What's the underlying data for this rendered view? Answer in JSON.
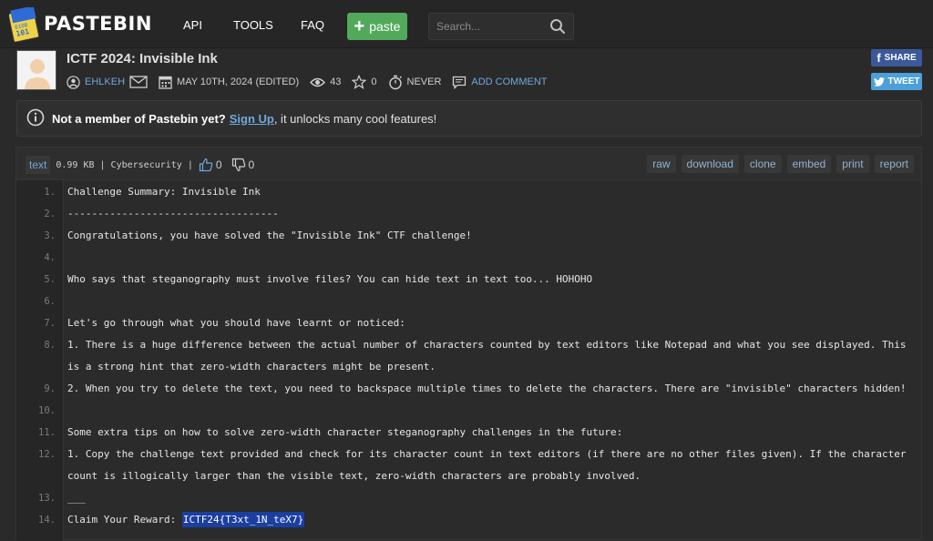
{
  "header": {
    "brand": "PASTEBIN",
    "logo_text": "1010 0100 101",
    "nav": [
      "API",
      "TOOLS",
      "FAQ"
    ],
    "paste_button": "paste",
    "search_placeholder": "Search..."
  },
  "post": {
    "title": "ICTF 2024: Invisible Ink",
    "author": "EHLKEH",
    "date": "MAY 10TH, 2024 (EDITED)",
    "views": "43",
    "stars": "0",
    "expires": "NEVER",
    "add_comment": "ADD COMMENT"
  },
  "share": {
    "facebook": "SHARE",
    "twitter": "TWEET"
  },
  "notice": {
    "bold": "Not a member of Pastebin yet?",
    "signup": "Sign Up",
    "rest": ", it unlocks many cool features!"
  },
  "toolbar": {
    "syntax": "text",
    "size_info": "0.99 KB | Cybersecurity |",
    "likes": "0",
    "dislikes": "0",
    "actions": [
      "raw",
      "download",
      "clone",
      "embed",
      "print",
      "report"
    ]
  },
  "code": {
    "lines": [
      {
        "n": "1.",
        "t": "Challenge Summary: Invisible Ink"
      },
      {
        "n": "2.",
        "t": "-----------------------------------"
      },
      {
        "n": "3.",
        "t": "Congratulations, you have solved the \"Invisible Ink\" CTF challenge!"
      },
      {
        "n": "4.",
        "t": ""
      },
      {
        "n": "5.",
        "t": "Who says that steganography must involve files? You can hide text in text too... HOHOHO"
      },
      {
        "n": "6.",
        "t": ""
      },
      {
        "n": "7.",
        "t": "Let's go through what you should have learnt or noticed:"
      },
      {
        "n": "8.",
        "t": "1. There is a huge difference between the actual number of characters counted by text editors like Notepad and what you see displayed. This"
      },
      {
        "n": "",
        "t": "is a strong hint that zero-width characters might be present."
      },
      {
        "n": "9.",
        "t": "2. When you try to delete the text, you need to backspace multiple times to delete the characters. There are \"invisible\" characters hidden!"
      },
      {
        "n": "10.",
        "t": ""
      },
      {
        "n": "11.",
        "t": "Some extra tips on how to solve zero-width character steganography challenges in the future:"
      },
      {
        "n": "12.",
        "t": "1. Copy the challenge text provided and check for its character count in text editors (if there are no other files given). If the character"
      },
      {
        "n": "",
        "t": "count is illogically larger than the visible text, zero-width characters are probably involved."
      },
      {
        "n": "13.",
        "t": "___"
      },
      {
        "n": "14.",
        "t": "Claim Your Reward: "
      }
    ],
    "flag": "ICTF24{T3xt_1N_teX7}"
  }
}
